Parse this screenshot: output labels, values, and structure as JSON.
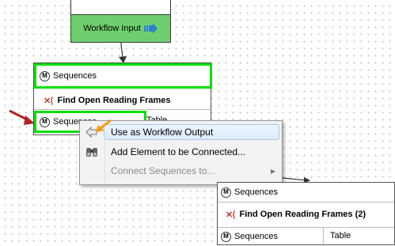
{
  "workflow_input": {
    "label": "Workflow Input"
  },
  "node1": {
    "input_port": "Sequences",
    "title": "Find Open Reading Frames",
    "output_port": "Sequences",
    "output_port2": "Table"
  },
  "context_menu": {
    "items": [
      {
        "label": "Use as Workflow Output",
        "icon": "workflow-output-icon"
      },
      {
        "label": "Add Element to be Connected...",
        "icon": "binoculars-icon"
      },
      {
        "label": "Connect Sequences to...",
        "icon": "none",
        "disabled": true
      }
    ]
  },
  "node2": {
    "input_port": "Sequences",
    "title": "Find Open Reading Frames (2)",
    "output_port": "Sequences",
    "output_port2": "Table"
  },
  "colors": {
    "highlight_green": "#00e000",
    "input_green": "#6fcf6f",
    "accent_orange": "#f39c12",
    "annotation_red": "#c0392b"
  }
}
